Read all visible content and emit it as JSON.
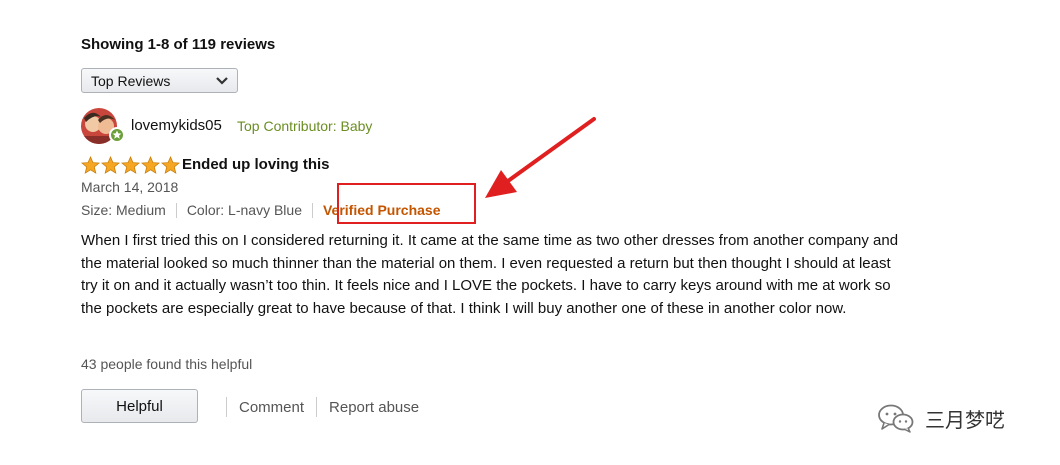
{
  "reviews_summary": "Showing 1-8 of 119 reviews",
  "sort": {
    "selected": "Top Reviews",
    "icon": "chevron-down-icon"
  },
  "review": {
    "username": "lovemykids05",
    "badge": "Top Contributor: Baby",
    "rating": 5,
    "rating_max": 5,
    "title": "Ended up loving this",
    "date": "March 14, 2018",
    "size": "Size: Medium",
    "color": "Color: L-navy Blue",
    "verified": "Verified Purchase",
    "body": "When I first tried this on I considered returning it. It came at the same time as two other dresses from another company and the material looked so much thinner than the material on them. I even requested a return but then thought I should at least try it on and it actually wasn’t too thin. It feels nice and I LOVE the pockets. I have to carry keys around with me at work so the pockets are especially great to have because of that. I think I will buy another one of these in another color now.",
    "helpful_count": "43 people found this helpful",
    "actions": {
      "helpful": "Helpful",
      "comment": "Comment",
      "report": "Report abuse"
    }
  },
  "colors": {
    "star": "#f5a623",
    "verified": "#c45500",
    "contributor": "#6b8e23",
    "highlight": "#e02020"
  },
  "watermark": {
    "text": "三月梦呓",
    "icon": "wechat-icon"
  }
}
